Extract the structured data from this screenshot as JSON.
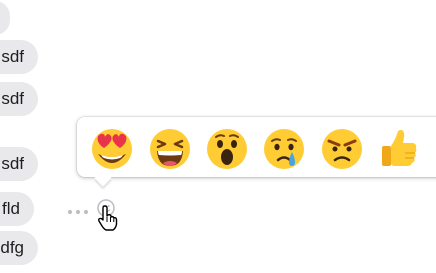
{
  "messages": [
    {
      "text": "sd"
    },
    {
      "text": "sdf"
    },
    {
      "text": "sdf"
    },
    {
      "text": "fld"
    },
    {
      "text": "dfg"
    }
  ],
  "reactions": [
    {
      "name": "love",
      "icon": "heart-eyes-emoji"
    },
    {
      "name": "haha",
      "icon": "laughing-emoji"
    },
    {
      "name": "wow",
      "icon": "surprised-emoji"
    },
    {
      "name": "sad",
      "icon": "crying-emoji"
    },
    {
      "name": "angry",
      "icon": "angry-emoji"
    },
    {
      "name": "like",
      "icon": "thumbs-up-emoji"
    }
  ],
  "colors": {
    "bubble": "#e9e9eb",
    "emoji_yellow": "#ffcc33",
    "heart_red": "#e8334a",
    "tear_blue": "#4aa3df",
    "angry_brown": "#8a3c12"
  }
}
